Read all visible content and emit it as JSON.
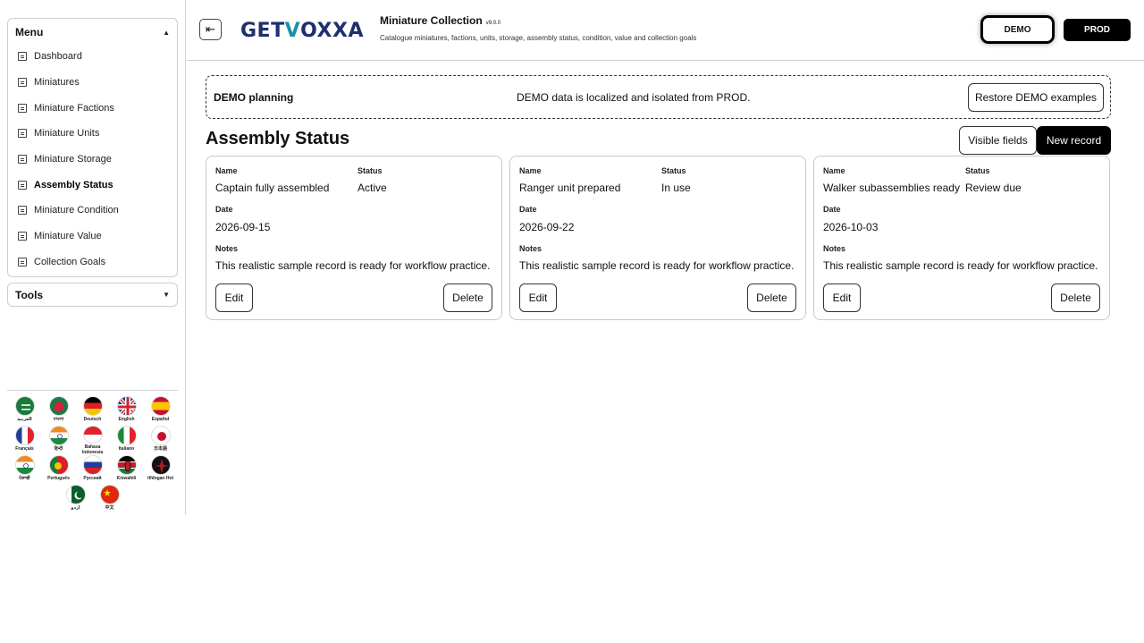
{
  "sidebar": {
    "menu_title": "Menu",
    "tools_title": "Tools",
    "items": [
      {
        "label": "Dashboard"
      },
      {
        "label": "Miniatures"
      },
      {
        "label": "Miniature Factions"
      },
      {
        "label": "Miniature Units"
      },
      {
        "label": "Miniature Storage"
      },
      {
        "label": "Assembly Status",
        "active": true
      },
      {
        "label": "Miniature Condition"
      },
      {
        "label": "Miniature Value"
      },
      {
        "label": "Collection Goals"
      }
    ],
    "languages": [
      {
        "label": "العربية",
        "icon": "flag-saudi-arabia"
      },
      {
        "label": "বাংলা",
        "icon": "flag-bangladesh"
      },
      {
        "label": "Deutsch",
        "icon": "flag-germany"
      },
      {
        "label": "English",
        "icon": "flag-uk"
      },
      {
        "label": "Español",
        "icon": "flag-spain"
      },
      {
        "label": "Français",
        "icon": "flag-france"
      },
      {
        "label": "हिन्दी",
        "icon": "flag-india"
      },
      {
        "label": "Bahasa Indonesia",
        "icon": "flag-indonesia"
      },
      {
        "label": "Italiano",
        "icon": "flag-italy"
      },
      {
        "label": "日本語",
        "icon": "flag-japan"
      },
      {
        "label": "ਪੰਜਾਬੀ",
        "icon": "flag-india"
      },
      {
        "label": "Português",
        "icon": "flag-portugal"
      },
      {
        "label": "Русский",
        "icon": "flag-russia"
      },
      {
        "label": "Kiswahili",
        "icon": "flag-kenya"
      },
      {
        "label": "tlhIngan Hol",
        "icon": "flag-klingon"
      },
      {
        "label": "اردو",
        "icon": "flag-pakistan"
      },
      {
        "label": "中文",
        "icon": "flag-china"
      }
    ]
  },
  "header": {
    "logo_text_a": "GET",
    "logo_text_v": "V",
    "logo_text_b": "OXXA",
    "app_title": "Miniature Collection",
    "version": "v9.0.0",
    "subtitle": "Catalogue miniatures, factions, units, storage, assembly status, condition, value and collection goals",
    "demo_label": "DEMO",
    "prod_label": "PROD"
  },
  "banner": {
    "title": "DEMO planning",
    "message": "DEMO data is localized and isolated from PROD.",
    "restore_label": "Restore DEMO examples"
  },
  "main": {
    "title": "Assembly Status",
    "visible_fields_label": "Visible fields",
    "new_record_label": "New record",
    "field_labels": {
      "name": "Name",
      "status": "Status",
      "date": "Date",
      "notes": "Notes"
    },
    "edit_label": "Edit",
    "delete_label": "Delete",
    "records": [
      {
        "name": "Captain fully assembled",
        "status": "Active",
        "date": "2026-09-15",
        "notes": "This realistic sample record is ready for workflow practice."
      },
      {
        "name": "Ranger unit prepared",
        "status": "In use",
        "date": "2026-09-22",
        "notes": "This realistic sample record is ready for workflow practice."
      },
      {
        "name": "Walker subassemblies ready",
        "status": "Review due",
        "date": "2026-10-03",
        "notes": "This realistic sample record is ready for workflow practice."
      }
    ]
  }
}
